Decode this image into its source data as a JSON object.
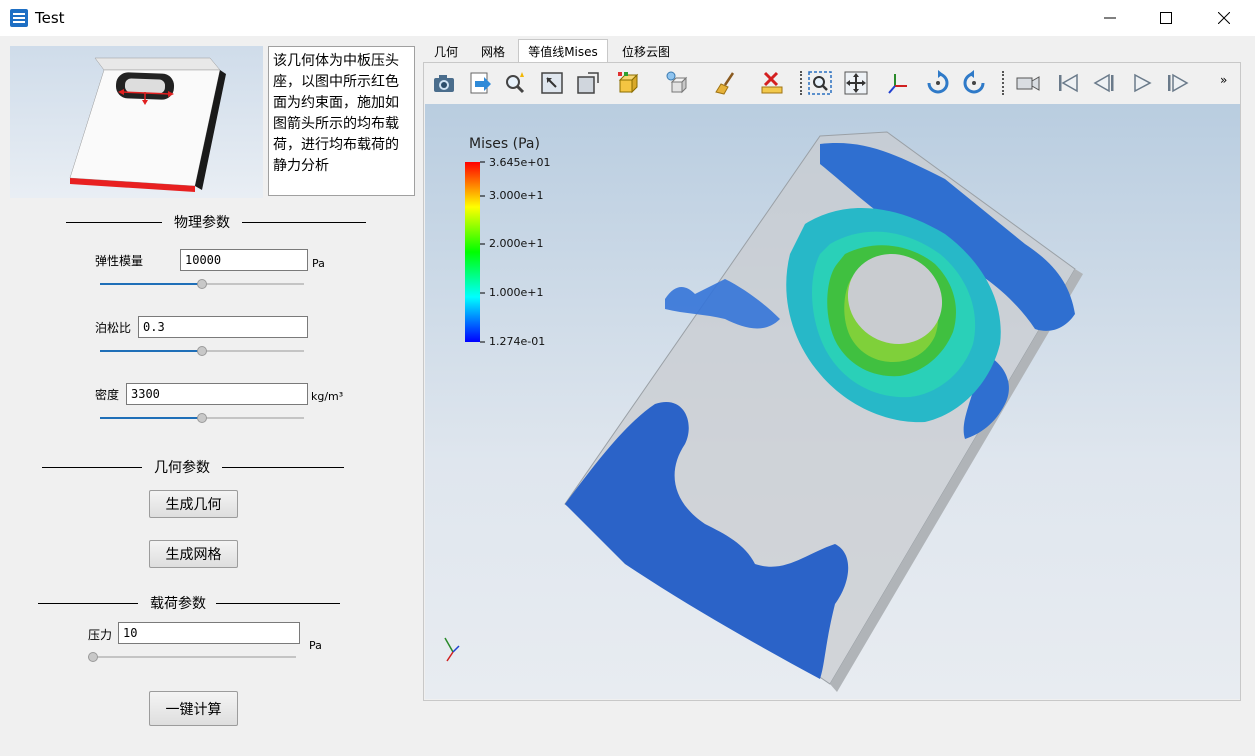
{
  "window": {
    "title": "Test"
  },
  "preview": {
    "description": "该几何体为中板压头座，以图中所示红色面为约束面，施加如图箭头所示的均布载荷，进行均布载荷的静力分析"
  },
  "sections": {
    "physical": "物理参数",
    "geometry": "几何参数",
    "load": "载荷参数"
  },
  "params": {
    "elastic_modulus": {
      "label": "弹性模量",
      "value": "10000",
      "unit": "Pa",
      "slider_fraction": 0.5
    },
    "poisson_ratio": {
      "label": "泊松比",
      "value": "0.3",
      "slider_fraction": 0.5
    },
    "density": {
      "label": "密度",
      "value": "3300",
      "unit": "kg/m³",
      "slider_fraction": 0.5
    },
    "pressure": {
      "label": "压力",
      "value": "10",
      "unit": "Pa",
      "slider_fraction": 0.0
    }
  },
  "buttons": {
    "generate_geometry": "生成几何",
    "generate_mesh": "生成网格",
    "compute": "一键计算"
  },
  "tabs": [
    {
      "label": "几何",
      "active": false
    },
    {
      "label": "网格",
      "active": false
    },
    {
      "label": "等值线Mises",
      "active": true
    },
    {
      "label": "位移云图",
      "active": false
    }
  ],
  "toolbar": {
    "icons": [
      "camera-icon",
      "export-icon",
      "magic-search-icon",
      "fit-view-icon",
      "box-view-icon",
      "color-cube-icon",
      "light-cube-icon",
      "broom-icon",
      "delete-ruler-icon",
      "zoom-box-icon",
      "pan-icon",
      "axes-icon",
      "rotate-cw-icon",
      "rotate-ccw-icon",
      "video-camera-icon",
      "skip-first-icon",
      "step-back-icon",
      "play-icon",
      "step-forward-icon"
    ],
    "overflow": "»"
  },
  "legend": {
    "title": "Mises (Pa)",
    "ticks": [
      "3.645e+01",
      "3.000e+1",
      "2.000e+1",
      "1.000e+1",
      "1.274e-01"
    ],
    "colors": [
      "#ff0000",
      "#00ff00",
      "#0000ff"
    ]
  }
}
